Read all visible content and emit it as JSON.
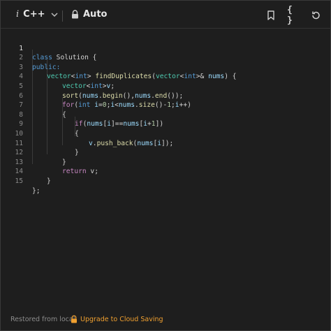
{
  "toolbar": {
    "info_glyph": "i",
    "language": "C++",
    "mode": "Auto",
    "icons": [
      "chevron-down-icon",
      "lock-icon",
      "bookmark-icon",
      "braces-icon",
      "reset-icon"
    ],
    "braces_label": "{ }"
  },
  "editor": {
    "lines": [
      {
        "n": "1"
      },
      {
        "n": "2"
      },
      {
        "n": "3"
      },
      {
        "n": "4"
      },
      {
        "n": "5"
      },
      {
        "n": "6"
      },
      {
        "n": "7"
      },
      {
        "n": "8"
      },
      {
        "n": "9"
      },
      {
        "n": "10"
      },
      {
        "n": "11"
      },
      {
        "n": "12"
      },
      {
        "n": "13"
      },
      {
        "n": "14"
      },
      {
        "n": "15"
      }
    ],
    "tokens": {
      "l1a": "class",
      "l1b": " Solution {",
      "l2": "public:",
      "l3a": "vector",
      "l3b": "<",
      "l3c": "int",
      "l3d": "> ",
      "l3e": "findDuplicates",
      "l3f": "(",
      "l3g": "vector",
      "l3h": "<",
      "l3i": "int",
      "l3j": ">& ",
      "l3k": "nums",
      "l3l": ") {",
      "l4a": "vector",
      "l4b": "<",
      "l4c": "int",
      "l4d": ">",
      "l4e": "v",
      "l4f": ";",
      "l5a": "sort",
      "l5b": "(",
      "l5c": "nums",
      "l5d": ".",
      "l5e": "begin",
      "l5f": "(),",
      "l5g": "nums",
      "l5h": ".",
      "l5i": "end",
      "l5j": "());",
      "l6a": "for",
      "l6b": "(",
      "l6c": "int",
      "l6d": " ",
      "l6e": "i",
      "l6f": "=",
      "l6g": "0",
      "l6h": ";",
      "l6i": "i",
      "l6j": "<",
      "l6k": "nums",
      "l6l": ".",
      "l6m": "size",
      "l6n": "()-",
      "l6o": "1",
      "l6p": ";",
      "l6q": "i",
      "l6r": "++)",
      "l7": "{",
      "l8a": "if",
      "l8b": "(",
      "l8c": "nums",
      "l8d": "[",
      "l8e": "i",
      "l8f": "]==",
      "l8g": "nums",
      "l8h": "[",
      "l8i": "i",
      "l8j": "+",
      "l8k": "1",
      "l8l": "])",
      "l9": "{",
      "l10a": "v",
      "l10b": ".",
      "l10c": "push_back",
      "l10d": "(",
      "l10e": "nums",
      "l10f": "[",
      "l10g": "i",
      "l10h": "]);",
      "l11": "}",
      "l12": "}",
      "l13a": "return",
      "l13b": " v;",
      "l14": "}",
      "l15": "};"
    }
  },
  "footer": {
    "status": "Restored from local",
    "upgrade": "Upgrade to Cloud Saving",
    "upgrade_icon": "lock-icon"
  },
  "colors": {
    "background": "#1e1e1e",
    "keyword": "#569cd6",
    "type": "#4ec9b0",
    "function": "#dcdcaa",
    "variable": "#9cdcfe",
    "number": "#b5cea8",
    "upgrade": "#f0a030"
  }
}
